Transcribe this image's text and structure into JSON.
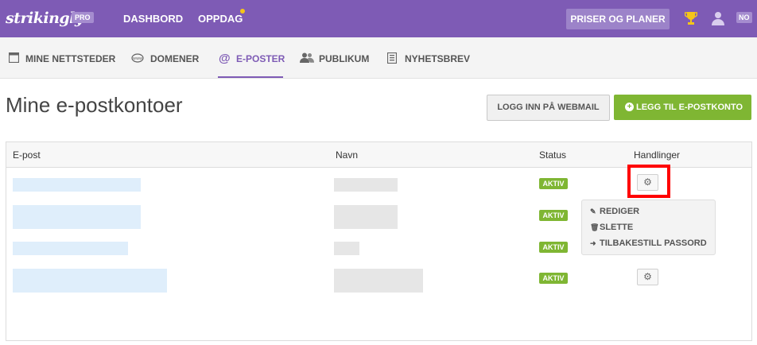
{
  "topbar": {
    "logo": "strikingly",
    "pro_badge": "PRO",
    "nav": [
      {
        "label": "DASHBORD"
      },
      {
        "label": "OPPDAG"
      }
    ],
    "pricing_button": "PRISER OG PLANER",
    "lang_badge": "NO"
  },
  "subnav": {
    "items": [
      {
        "label": "MINE NETTSTEDER",
        "icon": "browser-window-icon"
      },
      {
        "label": "DOMENER",
        "icon": "www-icon"
      },
      {
        "label": "E-POSTER",
        "icon": "at-icon",
        "active": true
      },
      {
        "label": "PUBLIKUM",
        "icon": "people-icon"
      },
      {
        "label": "NYHETSBREV",
        "icon": "newsletter-icon"
      }
    ],
    "active_color": "#7e5bb5"
  },
  "main": {
    "title": "Mine e-postkontoer",
    "webmail_button": "LOGG INN PÅ WEBMAIL",
    "add_button": "LEGG TIL E-POSTKONTO"
  },
  "table": {
    "headers": {
      "email": "E-post",
      "name": "Navn",
      "status": "Status",
      "actions": "Handlinger"
    },
    "rows": [
      {
        "status": "AKTIV"
      },
      {
        "status": "AKTIV"
      },
      {
        "status": "AKTIV"
      },
      {
        "status": "AKTIV"
      }
    ]
  },
  "actions_menu": {
    "items": [
      {
        "label": "REDIGER",
        "icon": "pencil-icon"
      },
      {
        "label": "SLETTE",
        "icon": "trash-icon"
      },
      {
        "label": "TILBAKESTILL PASSORD",
        "icon": "arrow-right-icon"
      }
    ]
  },
  "colors": {
    "topbar": "#7e5bb5",
    "green": "#7fb633",
    "highlight": "#ff0000"
  }
}
